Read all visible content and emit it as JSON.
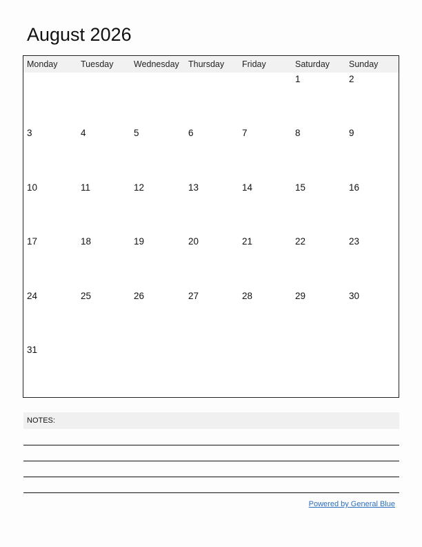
{
  "title": "August 2026",
  "weekdays": [
    "Monday",
    "Tuesday",
    "Wednesday",
    "Thursday",
    "Friday",
    "Saturday",
    "Sunday"
  ],
  "weeks": [
    [
      "",
      "",
      "",
      "",
      "",
      "1",
      "2"
    ],
    [
      "3",
      "4",
      "5",
      "6",
      "7",
      "8",
      "9"
    ],
    [
      "10",
      "11",
      "12",
      "13",
      "14",
      "15",
      "16"
    ],
    [
      "17",
      "18",
      "19",
      "20",
      "21",
      "22",
      "23"
    ],
    [
      "24",
      "25",
      "26",
      "27",
      "28",
      "29",
      "30"
    ],
    [
      "31",
      "",
      "",
      "",
      "",
      "",
      ""
    ]
  ],
  "notes": {
    "label": "NOTES:"
  },
  "footer": {
    "powered_by": "Powered by General Blue",
    "link_color": "#2a6ebd"
  }
}
